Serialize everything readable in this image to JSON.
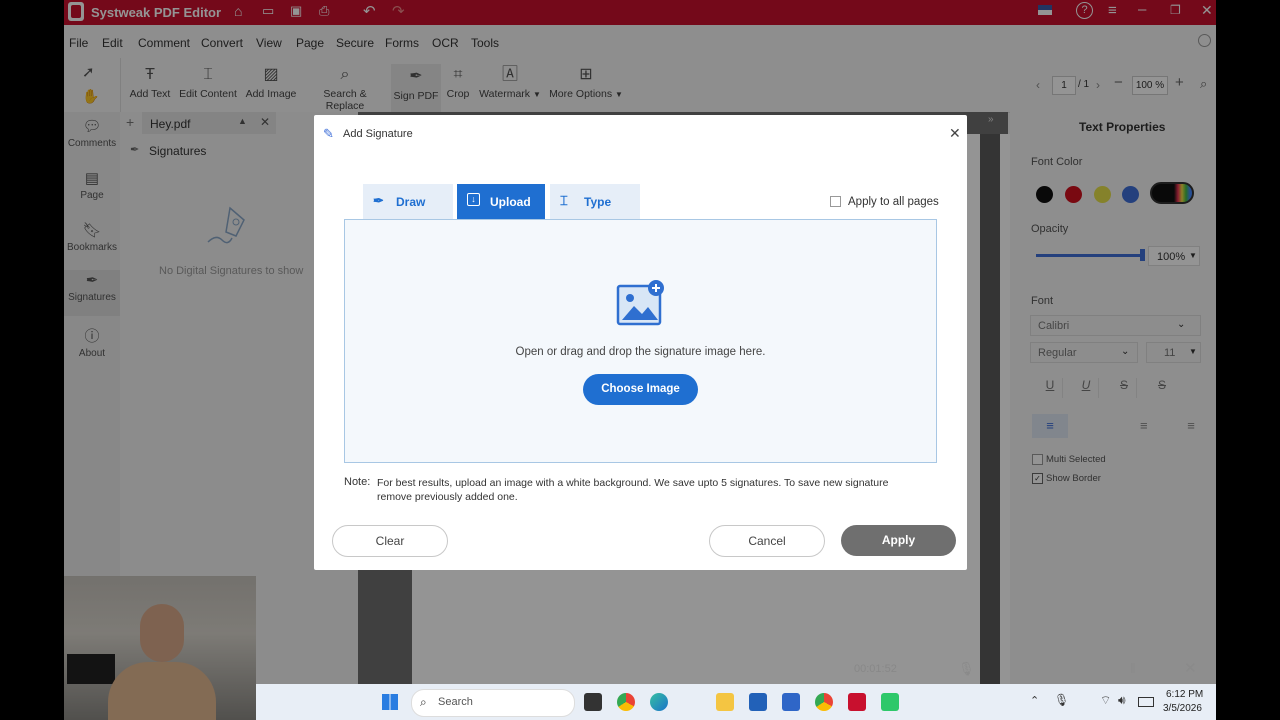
{
  "app": {
    "title": "Systweak PDF Editor"
  },
  "menu": [
    "File",
    "Edit",
    "Comment",
    "Convert",
    "View",
    "Page",
    "Secure",
    "Forms",
    "OCR",
    "Tools"
  ],
  "toolbar": {
    "tools": [
      {
        "label": "Add Text",
        "icon": "add-text-icon"
      },
      {
        "label": "Edit Content",
        "icon": "edit-content-icon"
      },
      {
        "label": "Add Image",
        "icon": "add-image-icon"
      },
      {
        "label": "Search & Replace",
        "icon": "search-replace-icon"
      },
      {
        "label": "Sign PDF",
        "icon": "sign-pdf-icon"
      },
      {
        "label": "Crop",
        "icon": "crop-icon"
      },
      {
        "label": "Watermark",
        "icon": "watermark-icon"
      },
      {
        "label": "More Options",
        "icon": "more-options-icon"
      }
    ],
    "page_current": "1",
    "page_total": "/ 1",
    "zoom": "100 %"
  },
  "rail": [
    {
      "label": "Comments"
    },
    {
      "label": "Page"
    },
    {
      "label": "Bookmarks"
    },
    {
      "label": "Signatures"
    },
    {
      "label": "About"
    }
  ],
  "document_tab": {
    "name": "Hey.pdf"
  },
  "signatures_panel": {
    "title": "Signatures",
    "empty_text": "No Digital Signatures to show"
  },
  "properties": {
    "title": "Text Properties",
    "font_color_label": "Font Color",
    "swatches": [
      "#111111",
      "#d0101e",
      "#e6e04a",
      "#3f6fd8",
      "#111111"
    ],
    "opacity_label": "Opacity",
    "opacity_value": "100%",
    "opacity_level": 1.0,
    "font_label": "Font",
    "font_family": "Calibri",
    "font_style": "Regular",
    "font_size": "11",
    "multi_selected": "Multi Selected",
    "show_border": "Show Border"
  },
  "dialog": {
    "title": "Add Signature",
    "tabs": [
      "Draw",
      "Upload",
      "Type"
    ],
    "active_tab": "Upload",
    "apply_all": "Apply to all pages",
    "drop_text": "Open or drag and drop the signature image here.",
    "choose_button": "Choose Image",
    "note_label": "Note:",
    "note_text": "For best results, upload an image with a white background. We save upto 5 signatures. To save new signature remove previously added one.",
    "clear_button": "Clear",
    "cancel_button": "Cancel",
    "apply_button": "Apply"
  },
  "recorder": {
    "time": "00:01:52"
  },
  "taskbar": {
    "search_placeholder": "Search",
    "time": "6:12 PM",
    "date": "3/5/2026"
  },
  "colors": {
    "brand": "#c8102e",
    "accent": "#1f6fd1",
    "apply": "#6f6f6f"
  }
}
